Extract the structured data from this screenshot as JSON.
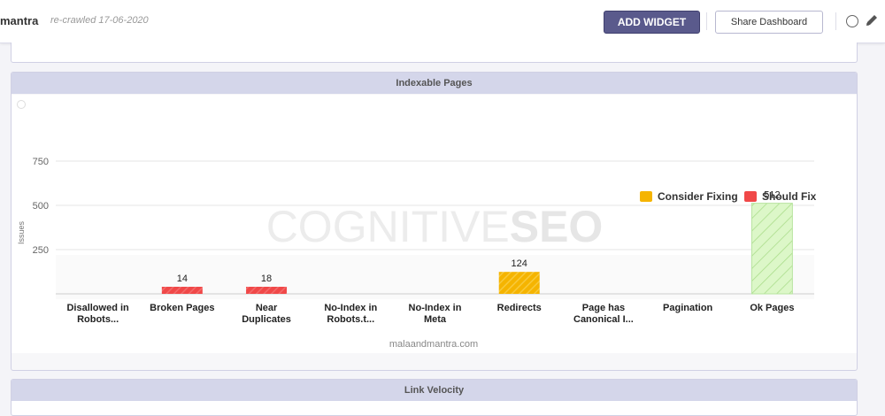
{
  "header": {
    "site_name": "mantra",
    "crawl_date": "re-crawled 17-06-2020",
    "add_widget_label": "ADD WIDGET",
    "share_label": "Share Dashboard"
  },
  "panels": {
    "indexable_title": "Indexable Pages",
    "link_velocity_title": "Link Velocity"
  },
  "chart": {
    "watermark_light": "COGNITIVE",
    "watermark_bold": "SEO",
    "domain": "malaandmantra.com",
    "colors": {
      "consider_fixing": "#f5b400",
      "should_fix": "#f04848",
      "ok": "#c8f0b0"
    }
  },
  "chart_data": {
    "type": "bar",
    "ylabel": "Issues",
    "xlabel": "",
    "ylim": [
      0,
      750
    ],
    "yticks": [
      250,
      500,
      750
    ],
    "grid": true,
    "legend_position": "top-right",
    "legend": [
      "Consider Fixing",
      "Should Fix"
    ],
    "categories": [
      [
        "Disallowed in",
        "Robots..."
      ],
      [
        "Broken Pages"
      ],
      [
        "Near",
        "Duplicates"
      ],
      [
        "No-Index in",
        "Robots.t..."
      ],
      [
        "No-Index in",
        "Meta"
      ],
      [
        "Redirects"
      ],
      [
        "Page has",
        "Canonical I..."
      ],
      [
        "Pagination"
      ],
      [
        "Ok Pages"
      ]
    ],
    "values": [
      null,
      14,
      18,
      null,
      null,
      124,
      null,
      null,
      512
    ],
    "bar_series": [
      null,
      "Should Fix",
      "Should Fix",
      null,
      null,
      "Consider Fixing",
      null,
      null,
      "Ok"
    ]
  }
}
